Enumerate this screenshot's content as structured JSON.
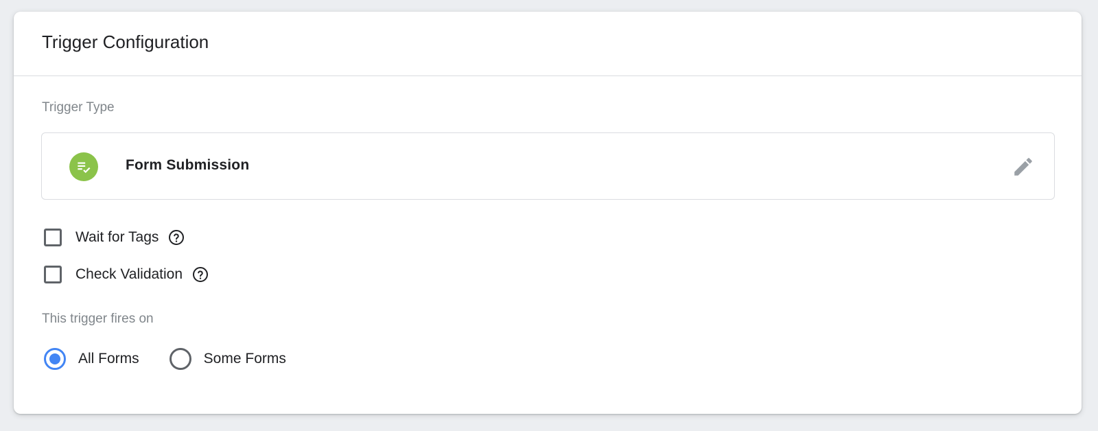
{
  "card": {
    "title": "Trigger Configuration"
  },
  "trigger_type": {
    "label": "Trigger Type",
    "name": "Form Submission",
    "icon": "form-submission-icon",
    "icon_color": "#8bc34a"
  },
  "options": [
    {
      "label": "Wait for Tags",
      "checked": false
    },
    {
      "label": "Check Validation",
      "checked": false
    }
  ],
  "fires_on": {
    "label": "This trigger fires on",
    "choices": [
      {
        "label": "All Forms",
        "selected": true
      },
      {
        "label": "Some Forms",
        "selected": false
      }
    ]
  },
  "colors": {
    "accent": "#4285f4",
    "text": "#202124",
    "secondary_text": "#80868b"
  }
}
